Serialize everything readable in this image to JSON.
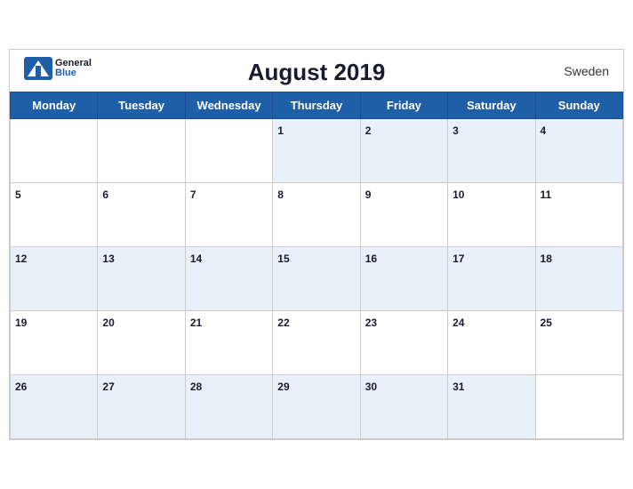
{
  "header": {
    "title": "August 2019",
    "country": "Sweden",
    "logo_general": "General",
    "logo_blue": "Blue"
  },
  "weekdays": [
    "Monday",
    "Tuesday",
    "Wednesday",
    "Thursday",
    "Friday",
    "Saturday",
    "Sunday"
  ],
  "weeks": [
    [
      null,
      null,
      null,
      1,
      2,
      3,
      4
    ],
    [
      5,
      6,
      7,
      8,
      9,
      10,
      11
    ],
    [
      12,
      13,
      14,
      15,
      16,
      17,
      18
    ],
    [
      19,
      20,
      21,
      22,
      23,
      24,
      25
    ],
    [
      26,
      27,
      28,
      29,
      30,
      31,
      null
    ]
  ],
  "accent_color": "#1e5fa8"
}
